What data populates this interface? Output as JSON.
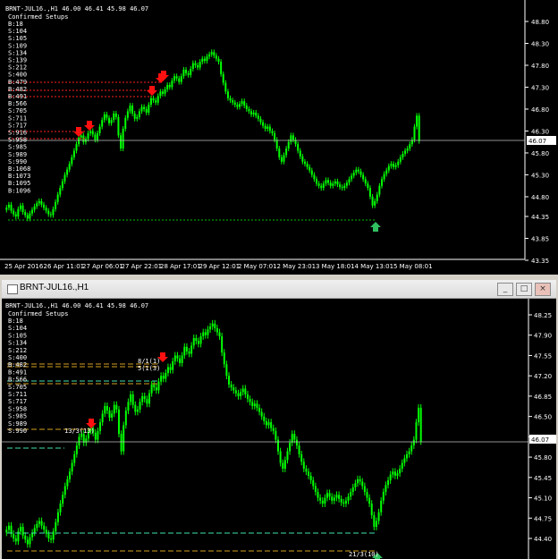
{
  "top_chart": {
    "header": "BRNT-JUL16.,H1  46.00 46.41 45.98 46.07",
    "subtitle": "Confirmed Setups",
    "setups": [
      "B:18",
      "S:104",
      "S:105",
      "S:109",
      "S:134",
      "S:139",
      "S:212",
      "S:400",
      "B:479",
      "B:482",
      "B:491",
      "B:566",
      "S:705",
      "S:711",
      "S:717",
      "S:916",
      "S:958",
      "S:985",
      "S:989",
      "S:990",
      "B:1068",
      "B:1073",
      "B:1095",
      "B:1096"
    ],
    "price_axis": [
      "48.80",
      "48.30",
      "47.80",
      "47.30",
      "46.80",
      "46.30",
      "45.80",
      "45.30",
      "44.80",
      "44.35",
      "43.85",
      "43.35"
    ],
    "current_price": "46.07",
    "time_axis": [
      "25 Apr 2016",
      "26 Apr 11:01",
      "27 Apr 06:01",
      "27 Apr 22:01",
      "28 Apr 17:01",
      "29 Apr 12:01",
      "2 May 07:01",
      "2 May 23:01",
      "3 May 18:01",
      "4 May 13:01",
      "5 May 08:01"
    ]
  },
  "window": {
    "title": "BRNT-JUL16.,H1",
    "buttons": {
      "minimize": "_",
      "restore": "□",
      "close": "×"
    }
  },
  "bottom_chart": {
    "header": "BRNT-JUL16.,H1  46.00 46.41 45.98 46.07",
    "subtitle": "Confirmed Setups",
    "setups": [
      "B:18",
      "S:104",
      "S:105",
      "S:134",
      "S:212",
      "S:400",
      "B:482",
      "B:491",
      "B:566",
      "S:705",
      "S:711",
      "S:717",
      "S:958",
      "S:985",
      "S:989",
      "S:990"
    ],
    "price_axis": [
      "48.25",
      "47.90",
      "47.55",
      "47.20",
      "46.85",
      "46.50",
      "46.15",
      "45.80",
      "45.45",
      "45.10",
      "44.75",
      "44.40"
    ],
    "current_price": "46.07",
    "annotations": [
      "13/3(13)",
      "8/1(1)",
      "5(1(3)",
      "21/3(10)"
    ]
  },
  "chart_data": {
    "type": "candlestick",
    "series_color": "#00ff00",
    "symbol": "BRNT-JUL16.",
    "timeframe": "H1",
    "ohlc_last": {
      "open": 46.0,
      "high": 46.41,
      "low": 45.98,
      "close": 46.07
    },
    "close": [
      44.55,
      44.62,
      44.48,
      44.4,
      44.35,
      44.52,
      44.6,
      44.45,
      44.38,
      44.3,
      44.42,
      44.5,
      44.58,
      44.65,
      44.7,
      44.62,
      44.55,
      44.48,
      44.4,
      44.38,
      44.52,
      44.68,
      44.85,
      45.0,
      45.15,
      45.3,
      45.42,
      45.55,
      45.7,
      45.85,
      46.0,
      46.15,
      46.2,
      46.05,
      46.12,
      46.25,
      46.3,
      46.22,
      46.1,
      46.25,
      46.4,
      46.55,
      46.68,
      46.6,
      46.48,
      46.55,
      46.7,
      46.62,
      46.2,
      45.9,
      46.35,
      46.6,
      46.75,
      46.88,
      46.7,
      46.58,
      46.62,
      46.75,
      46.85,
      46.8,
      46.72,
      46.9,
      47.05,
      47.0,
      46.95,
      47.1,
      47.2,
      47.15,
      47.25,
      47.35,
      47.3,
      47.45,
      47.55,
      47.5,
      47.42,
      47.55,
      47.7,
      47.62,
      47.58,
      47.72,
      47.85,
      47.8,
      47.75,
      47.88,
      47.95,
      47.9,
      48.0,
      48.05,
      48.1,
      48.02,
      47.95,
      47.88,
      47.6,
      47.4,
      47.2,
      47.05,
      47.0,
      46.95,
      46.9,
      46.85,
      46.92,
      46.98,
      46.88,
      46.8,
      46.75,
      46.68,
      46.72,
      46.65,
      46.58,
      46.5,
      46.42,
      46.35,
      46.4,
      46.3,
      46.25,
      46.1,
      45.9,
      45.7,
      45.6,
      45.75,
      45.9,
      46.05,
      46.2,
      46.1,
      46.0,
      45.85,
      45.72,
      45.6,
      45.55,
      45.48,
      45.4,
      45.3,
      45.2,
      45.1,
      45.05,
      45.0,
      45.1,
      45.18,
      45.12,
      45.05,
      45.1,
      45.15,
      45.08,
      45.02,
      45.0,
      45.05,
      45.12,
      45.2,
      45.28,
      45.35,
      45.42,
      45.38,
      45.3,
      45.2,
      45.1,
      45.0,
      44.8,
      44.6,
      44.7,
      44.85,
      45.05,
      45.2,
      45.32,
      45.4,
      45.5,
      45.55,
      45.48,
      45.52,
      45.6,
      45.7,
      45.78,
      45.85,
      45.9,
      46.0,
      46.1,
      46.4,
      46.65,
      46.07
    ]
  }
}
